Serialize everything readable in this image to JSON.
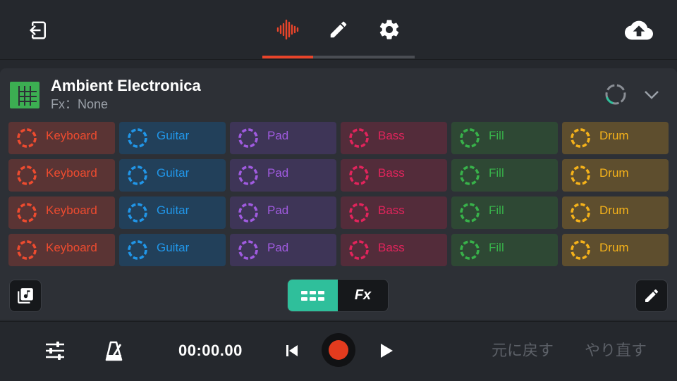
{
  "colors": {
    "accent_red": "#e8442a",
    "teal": "#2fbf9b",
    "background": "#25282d",
    "panel": "#2d3036",
    "song_icon": "#3cae52"
  },
  "header": {
    "icons": [
      "exit-icon",
      "waveform-icon",
      "pencil-icon",
      "gear-icon",
      "cloud-upload-icon"
    ],
    "active_tab": "waveform"
  },
  "song": {
    "title": "Ambient Electronica",
    "fx": "Fx：None"
  },
  "pads": {
    "columns": [
      {
        "label": "Keyboard",
        "color": "#ee4b2f",
        "bg": "#5a3434"
      },
      {
        "label": "Guitar",
        "color": "#2196e8",
        "bg": "#22405a"
      },
      {
        "label": "Pad",
        "color": "#a05be0",
        "bg": "#3e3557"
      },
      {
        "label": "Bass",
        "color": "#e2245c",
        "bg": "#532c3a"
      },
      {
        "label": "Fill",
        "color": "#38b24a",
        "bg": "#2e4834"
      },
      {
        "label": "Drum",
        "color": "#f5b21a",
        "bg": "#5e4e2e"
      }
    ],
    "rows": 4
  },
  "toolbar": {
    "fx_label": "Fx"
  },
  "transport": {
    "time": "00:00.00",
    "undo": "元に戻す",
    "redo": "やり直す"
  }
}
